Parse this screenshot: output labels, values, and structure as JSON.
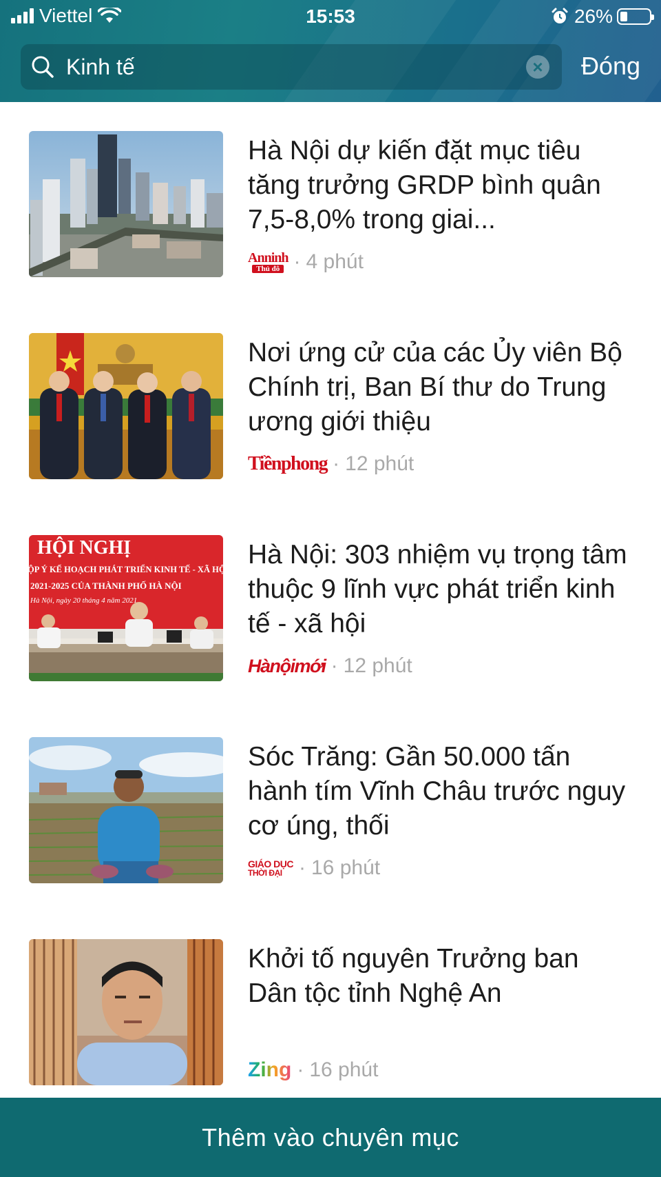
{
  "status_bar": {
    "carrier": "Viettel",
    "time": "15:53",
    "battery": "26%",
    "battery_level": 0.26
  },
  "search": {
    "query": "Kinh tế",
    "close_label": "Đóng"
  },
  "articles": [
    {
      "title": "Hà Nội dự kiến đặt mục tiêu tăng trưởng GRDP bình quân 7,5-8,0% trong giai...",
      "source": "An ninh Thủ đô",
      "source_logo_text": "Anninh",
      "source_logo_sub": "Thủ đô",
      "time": "4 phút",
      "image": "city-skyline-photo"
    },
    {
      "title": "Nơi ứng cử của các Ủy viên Bộ Chính trị, Ban Bí thư do Trung ương giới thiệu",
      "source": "Tiền phong",
      "source_logo_text": "Tiềnphong",
      "time": "12 phút",
      "image": "leaders-photo"
    },
    {
      "title": "Hà Nội: 303 nhiệm vụ trọng tâm thuộc 9 lĩnh vực phát triển kinh tế - xã hội",
      "source": "Hà Nội mới",
      "source_logo_text": "Hànộimới",
      "time": "12 phút",
      "image": "conference-photo",
      "image_text": {
        "line1": "HỘI NGHỊ",
        "line2": "ỘP Ý KẾ HOẠCH PHÁT TRIỂN KINH TẾ - XÃ HỘI",
        "line3": "2021-2025 CỦA THÀNH PHỐ HÀ NỘI",
        "line4": "Hà Nội, ngày 20 tháng 4 năm 2021"
      }
    },
    {
      "title": "Sóc Trăng: Gần 50.000 tấn hành tím Vĩnh Châu trước nguy cơ úng, thối",
      "source": "Giáo dục & Thời đại",
      "source_logo_text": "GIÁO DỤC",
      "source_logo_sub": "THỜI ĐẠI",
      "time": "16 phút",
      "image": "farmer-photo"
    },
    {
      "title": "Khởi tố nguyên Trưởng ban Dân tộc tỉnh Nghệ An",
      "source": "Zing",
      "source_logo_text": "Zing",
      "time": "16 phút",
      "image": "official-portrait-photo"
    }
  ],
  "bottom_button": {
    "label": "Thêm vào chuyên mục"
  },
  "colors": {
    "header": "#1b7f86",
    "bottom_bar": "#0f6a70",
    "meta_text": "#a9a9a9",
    "logo_red": "#d0101e"
  }
}
